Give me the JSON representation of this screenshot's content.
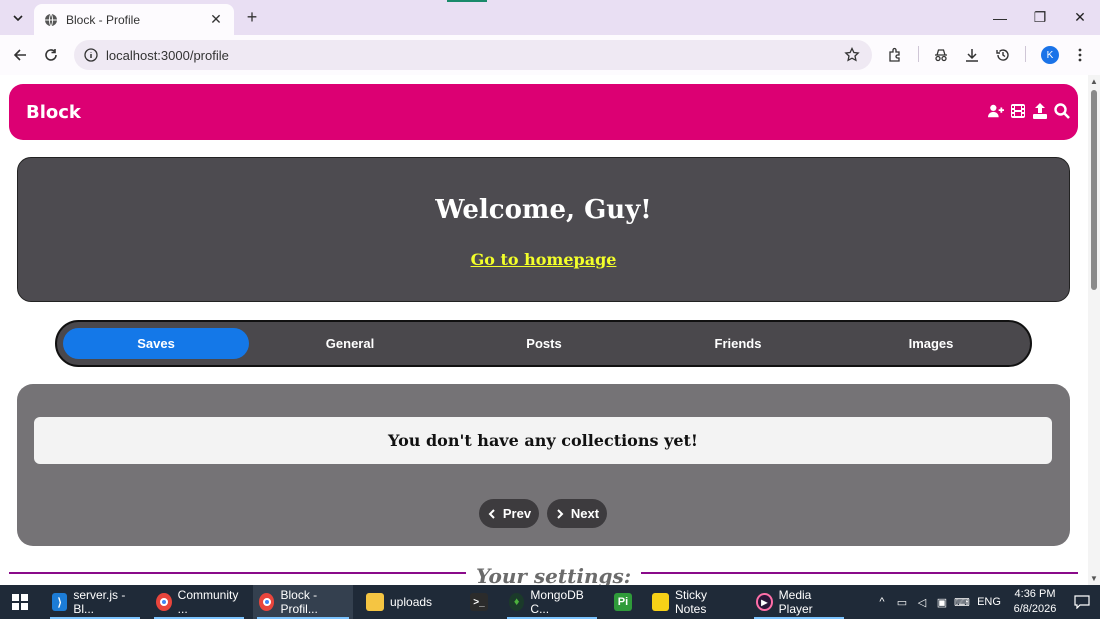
{
  "browser": {
    "tab_title": "Block - Profile",
    "url": "localhost:3000/profile",
    "profile_initial": "K"
  },
  "site": {
    "brand": "Block",
    "header_icons": [
      "add-user-icon",
      "film-icon",
      "upload-icon",
      "search-icon"
    ]
  },
  "welcome": {
    "title": "Welcome, Guy!",
    "home_link": "Go to homepage"
  },
  "profile_tabs": {
    "items": [
      {
        "label": "Saves",
        "active": true
      },
      {
        "label": "General",
        "active": false
      },
      {
        "label": "Posts",
        "active": false
      },
      {
        "label": "Friends",
        "active": false
      },
      {
        "label": "Images",
        "active": false
      }
    ]
  },
  "saves": {
    "empty_message": "You don't have any collections yet!",
    "prev_label": "Prev",
    "next_label": "Next"
  },
  "settings": {
    "heading": "Your settings:"
  },
  "taskbar": {
    "items": [
      {
        "label": "server.js - Bl...",
        "icon": "vscode-icon"
      },
      {
        "label": "Community ...",
        "icon": "chrome-icon"
      },
      {
        "label": "Block - Profil...",
        "icon": "chrome-icon"
      },
      {
        "label": "uploads",
        "icon": "folder-icon"
      },
      {
        "label": "",
        "icon": "terminal-icon"
      },
      {
        "label": "MongoDB C...",
        "icon": "mongodb-icon"
      },
      {
        "label": "",
        "icon": "pi-icon"
      },
      {
        "label": "Sticky Notes",
        "icon": "sticky-notes-icon"
      },
      {
        "label": "Media Player",
        "icon": "media-player-icon"
      }
    ],
    "language": "ENG",
    "time": "4:36 PM",
    "date": "6/8/2026"
  },
  "colors": {
    "header_pink": "#dc0073",
    "active_tab_blue": "#1478e8",
    "link_yellow": "#f3ff2a",
    "card_dark": "#4d4b50",
    "panel_gray": "#757376"
  }
}
